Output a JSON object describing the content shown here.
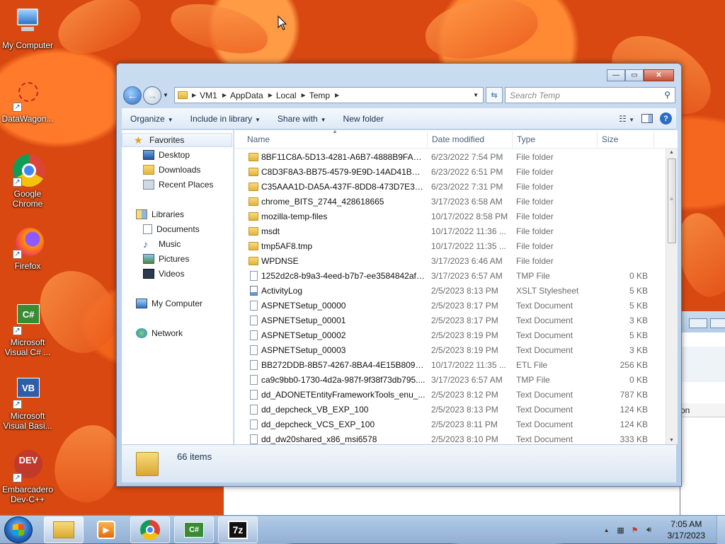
{
  "desktop": {
    "icons": [
      {
        "label": "My Computer",
        "icon": "computer-icon"
      },
      {
        "label": "DataWagon...",
        "icon": "datawagon-icon"
      },
      {
        "label": "Google Chrome",
        "icon": "chrome-icon"
      },
      {
        "label": "Firefox",
        "icon": "firefox-icon"
      },
      {
        "label": "Microsoft Visual C# ...",
        "icon": "visual-csharp-icon"
      },
      {
        "label": "Microsoft Visual Basi...",
        "icon": "visual-basic-icon"
      },
      {
        "label": "Embarcadero Dev-C++",
        "icon": "devcpp-icon"
      }
    ],
    "csharp_glyph": "C#",
    "vb_glyph": "VB",
    "dev_glyph": "DEV"
  },
  "window": {
    "controls": {
      "minimize": "—",
      "maximize": "▭",
      "close": "✕"
    },
    "back": "←",
    "forward": "→",
    "breadcrumb": [
      "VM1",
      "AppData",
      "Local",
      "Temp"
    ],
    "search_placeholder": "Search Temp",
    "toolbar": {
      "organize": "Organize",
      "include_in_library": "Include in library",
      "share_with": "Share with",
      "new_folder": "New folder",
      "help": "?"
    },
    "nav": {
      "favorites": "Favorites",
      "desktop": "Desktop",
      "downloads": "Downloads",
      "recent_places": "Recent Places",
      "libraries": "Libraries",
      "documents": "Documents",
      "music": "Music",
      "pictures": "Pictures",
      "videos": "Videos",
      "my_computer": "My Computer",
      "network": "Network"
    },
    "columns": {
      "name": "Name",
      "date": "Date modified",
      "type": "Type",
      "size": "Size"
    },
    "files": [
      {
        "name": "8BF11C8A-5D13-4281-A6B7-4888B9FAB8...",
        "date": "6/23/2022 7:54 PM",
        "type": "File folder",
        "size": "",
        "kind": "folder"
      },
      {
        "name": "C8D3F8A3-BB75-4579-9E9D-14AD41BD3...",
        "date": "6/23/2022 6:51 PM",
        "type": "File folder",
        "size": "",
        "kind": "folder"
      },
      {
        "name": "C35AAA1D-DA5A-437F-8DD8-473D7E327...",
        "date": "6/23/2022 7:31 PM",
        "type": "File folder",
        "size": "",
        "kind": "folder"
      },
      {
        "name": "chrome_BITS_2744_428618665",
        "date": "3/17/2023 6:58 AM",
        "type": "File folder",
        "size": "",
        "kind": "folder"
      },
      {
        "name": "mozilla-temp-files",
        "date": "10/17/2022 8:58 PM",
        "type": "File folder",
        "size": "",
        "kind": "folder"
      },
      {
        "name": "msdt",
        "date": "10/17/2022 11:36 ...",
        "type": "File folder",
        "size": "",
        "kind": "folder"
      },
      {
        "name": "tmp5AF8.tmp",
        "date": "10/17/2022 11:35 ...",
        "type": "File folder",
        "size": "",
        "kind": "folder"
      },
      {
        "name": "WPDNSE",
        "date": "3/17/2023 6:46 AM",
        "type": "File folder",
        "size": "",
        "kind": "folder"
      },
      {
        "name": "1252d2c8-b9a3-4eed-b7b7-ee3584842afb...",
        "date": "3/17/2023 6:57 AM",
        "type": "TMP File",
        "size": "0 KB",
        "kind": "file"
      },
      {
        "name": "ActivityLog",
        "date": "2/5/2023 8:13 PM",
        "type": "XSLT Stylesheet",
        "size": "5 KB",
        "kind": "xslt"
      },
      {
        "name": "ASPNETSetup_00000",
        "date": "2/5/2023 8:17 PM",
        "type": "Text Document",
        "size": "5 KB",
        "kind": "file"
      },
      {
        "name": "ASPNETSetup_00001",
        "date": "2/5/2023 8:17 PM",
        "type": "Text Document",
        "size": "3 KB",
        "kind": "file"
      },
      {
        "name": "ASPNETSetup_00002",
        "date": "2/5/2023 8:19 PM",
        "type": "Text Document",
        "size": "5 KB",
        "kind": "file"
      },
      {
        "name": "ASPNETSetup_00003",
        "date": "2/5/2023 8:19 PM",
        "type": "Text Document",
        "size": "3 KB",
        "kind": "file"
      },
      {
        "name": "BB272DDB-8B57-4267-8BA4-4E15B8092E...",
        "date": "10/17/2022 11:35 ...",
        "type": "ETL File",
        "size": "256 KB",
        "kind": "file"
      },
      {
        "name": "ca9c9bb0-1730-4d2a-987f-9f38f73db795....",
        "date": "3/17/2023 6:57 AM",
        "type": "TMP File",
        "size": "0 KB",
        "kind": "file"
      },
      {
        "name": "dd_ADONETEntityFrameworkTools_enu_...",
        "date": "2/5/2023 8:12 PM",
        "type": "Text Document",
        "size": "787 KB",
        "kind": "file"
      },
      {
        "name": "dd_depcheck_VB_EXP_100",
        "date": "2/5/2023 8:13 PM",
        "type": "Text Document",
        "size": "124 KB",
        "kind": "file"
      },
      {
        "name": "dd_depcheck_VCS_EXP_100",
        "date": "2/5/2023 8:11 PM",
        "type": "Text Document",
        "size": "124 KB",
        "kind": "file"
      },
      {
        "name": "dd_dw20shared_x86_msi6578",
        "date": "2/5/2023 8:10 PM",
        "type": "Text Document",
        "size": "333 KB",
        "kind": "file"
      }
    ],
    "status": "66 items"
  },
  "bg_window": {
    "text": "on"
  },
  "taskbar": {
    "apps": [
      "explorer",
      "media-player",
      "chrome",
      "visual-csharp",
      "7zip"
    ],
    "sevenzip_label": "7z",
    "csharp_label": "C#",
    "time": "7:05 AM",
    "date": "3/17/2023"
  }
}
